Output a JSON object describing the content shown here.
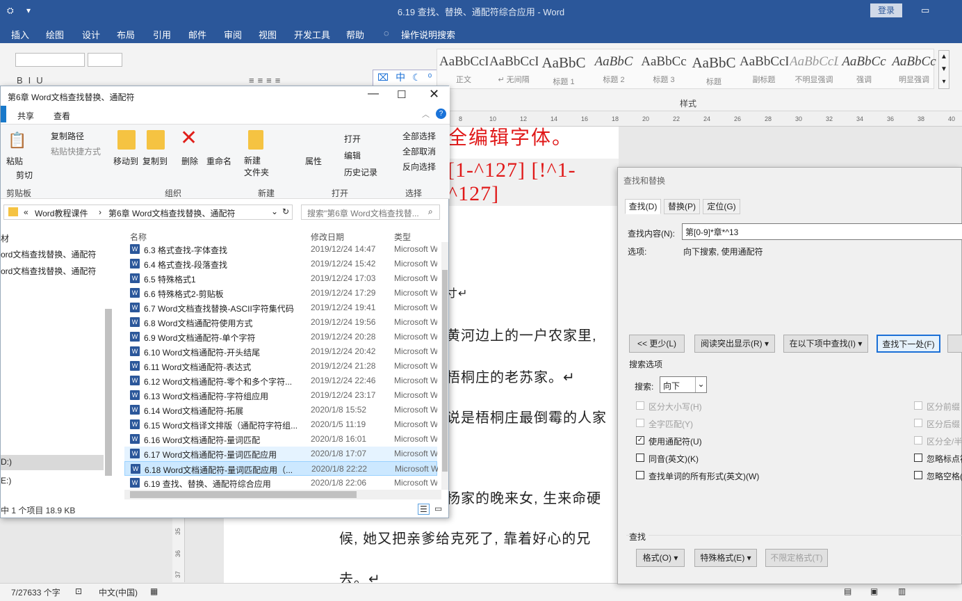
{
  "word": {
    "title": "6.19 查找、替换、通配符综合应用  -  Word",
    "login": "登录",
    "tabs": [
      "插入",
      "绘图",
      "设计",
      "布局",
      "引用",
      "邮件",
      "审阅",
      "视图",
      "开发工具",
      "帮助",
      "操作说明搜索"
    ],
    "styles": [
      {
        "sample": "AaBbCcD",
        "name": "正文"
      },
      {
        "sample": "AaBbCcD",
        "name": "↵ 无间隔"
      },
      {
        "sample": "AaBbC",
        "name": "标题 1"
      },
      {
        "sample": "AaBbC",
        "name": "标题 2"
      },
      {
        "sample": "AaBbCc",
        "name": "标题 3"
      },
      {
        "sample": "AaBbC",
        "name": "标题"
      },
      {
        "sample": "AaBbCcD",
        "name": "副标题"
      },
      {
        "sample": "AaBbCcL",
        "name": "不明显强调"
      },
      {
        "sample": "AaBbCc",
        "name": "强调"
      },
      {
        "sample": "AaBbCc",
        "name": "明显强调"
      }
    ],
    "styles_group": "样式",
    "ruler_ticks": [
      "8",
      "10",
      "12",
      "14",
      "16",
      "18",
      "20",
      "22",
      "24",
      "26",
      "28",
      "30",
      "32",
      "34",
      "36",
      "38",
      "40"
    ],
    "doc": {
      "red1": "全编辑字体。",
      "red2": "[1-^127] [!^1-^127]",
      "l1": "黄河边上的一户农家里,",
      "l2": "梧桐庄的老苏家。↵",
      "l3": "说是梧桐庄最倒霉的人家",
      "l4": "杨家的晚来女, 生来命硬",
      "l5": "候, 她又把亲爹给克死了, 靠着好心的兄",
      "l6": "去。↵",
      "frag": "寸↵"
    },
    "status": {
      "words": "7/27633 个字",
      "lang": "中文(中国)"
    },
    "vruler": [
      "35",
      "36",
      "37"
    ]
  },
  "explorer": {
    "title": "第6章 Word文档查找替换、通配符",
    "tabs": [
      "共享",
      "查看"
    ],
    "ribbon": {
      "paste": "粘贴",
      "copy_path": "复制路径",
      "paste_shortcut": "粘贴快捷方式",
      "cut": "剪切",
      "move_to": "移动到",
      "copy_to": "复制到",
      "delete": "删除",
      "rename": "重命名",
      "new_folder": "新建\n文件夹",
      "properties": "属性",
      "open": "打开",
      "edit": "编辑",
      "history": "历史记录",
      "select_all": "全部选择",
      "select_none": "全部取消",
      "invert": "反向选择",
      "groups": [
        "剪贴板",
        "组织",
        "新建",
        "打开",
        "选择"
      ]
    },
    "address": [
      "«",
      "Word教程课件",
      "›",
      "第6章 Word文档查找替换、通配符"
    ],
    "search_placeholder": "搜索\"第6章 Word文档查找替...",
    "nav": [
      "材",
      "ord文档查找替换、通配符",
      "ord文档查找替换、通配符",
      "D:)",
      "E:)"
    ],
    "columns": {
      "name": "名称",
      "date": "修改日期",
      "type": "类型"
    },
    "files": [
      {
        "name": "6.3 格式查找-字体查找",
        "date": "2019/12/24 14:47",
        "type": "Microsoft Word"
      },
      {
        "name": "6.4 格式查找-段落查找",
        "date": "2019/12/24 15:42",
        "type": "Microsoft Word"
      },
      {
        "name": "6.5 特殊格式1",
        "date": "2019/12/24 17:03",
        "type": "Microsoft Word"
      },
      {
        "name": "6.6 特殊格式2-剪贴板",
        "date": "2019/12/24 17:29",
        "type": "Microsoft Word"
      },
      {
        "name": "6.7 Word文档查找替换-ASCII字符集代码",
        "date": "2019/12/24 19:41",
        "type": "Microsoft Word"
      },
      {
        "name": "6.8 Word文档通配符使用方式",
        "date": "2019/12/24 19:56",
        "type": "Microsoft Word"
      },
      {
        "name": "6.9 Word文档通配符-单个字符",
        "date": "2019/12/24 20:28",
        "type": "Microsoft Word"
      },
      {
        "name": "6.10 Word文档通配符-开头结尾",
        "date": "2019/12/24 20:42",
        "type": "Microsoft Word"
      },
      {
        "name": "6.11 Word文档通配符-表达式",
        "date": "2019/12/24 21:28",
        "type": "Microsoft Word"
      },
      {
        "name": "6.12 Word文档通配符-零个和多个字符...",
        "date": "2019/12/24 22:46",
        "type": "Microsoft Word"
      },
      {
        "name": "6.13 Word文档通配符-字符组应用",
        "date": "2019/12/24 23:17",
        "type": "Microsoft Word"
      },
      {
        "name": "6.14 Word文档通配符-拓展",
        "date": "2020/1/8 15:52",
        "type": "Microsoft Word"
      },
      {
        "name": "6.15 Word文档译文排版（通配符字符组...",
        "date": "2020/1/5 11:19",
        "type": "Microsoft Word"
      },
      {
        "name": "6.16 Word文档通配符-量词匹配",
        "date": "2020/1/8 16:01",
        "type": "Microsoft Word"
      },
      {
        "name": "6.17 Word文档通配符-量词匹配应用",
        "date": "2020/1/8 17:07",
        "type": "Microsoft Word"
      },
      {
        "name": "6.18 Word文档通配符-量词匹配应用（...",
        "date": "2020/1/8 22:22",
        "type": "Microsoft Word"
      },
      {
        "name": "6.19 查找、替换、通配符综合应用",
        "date": "2020/1/8 22:06",
        "type": "Microsoft Word"
      }
    ],
    "status": "中 1 个项目  18.9 KB"
  },
  "find": {
    "title": "查找和替换",
    "tabs": [
      "查找(D)",
      "替换(P)",
      "定位(G)"
    ],
    "find_label": "查找内容(N):",
    "find_value": "第[0-9]*章*^13",
    "options_label": "选项:",
    "options_value": "向下搜索, 使用通配符",
    "buttons": {
      "less": "<< 更少(L)",
      "highlight": "阅读突出显示(R) ▾",
      "find_in": "在以下项中查找(I) ▾",
      "find_next": "查找下一处(F)"
    },
    "search_options": "搜索选项",
    "search_label": "搜索:",
    "search_value": "向下",
    "checks_left": [
      {
        "label": "区分大小写(H)",
        "checked": false,
        "disabled": true
      },
      {
        "label": "全字匹配(Y)",
        "checked": false,
        "disabled": true
      },
      {
        "label": "使用通配符(U)",
        "checked": true,
        "disabled": false
      },
      {
        "label": "同音(英文)(K)",
        "checked": false,
        "disabled": false
      },
      {
        "label": "查找单词的所有形式(英文)(W)",
        "checked": false,
        "disabled": false
      }
    ],
    "checks_right": [
      {
        "label": "区分前缀",
        "checked": false,
        "disabled": true
      },
      {
        "label": "区分后缀",
        "checked": false,
        "disabled": true
      },
      {
        "label": "区分全/半",
        "checked": false,
        "disabled": true
      },
      {
        "label": "忽略标点符",
        "checked": false,
        "disabled": false
      },
      {
        "label": "忽略空格(",
        "checked": false,
        "disabled": false
      }
    ],
    "find_section": "查找",
    "format": "格式(O) ▾",
    "special": "特殊格式(E) ▾",
    "no_format": "不限定格式(T)"
  }
}
